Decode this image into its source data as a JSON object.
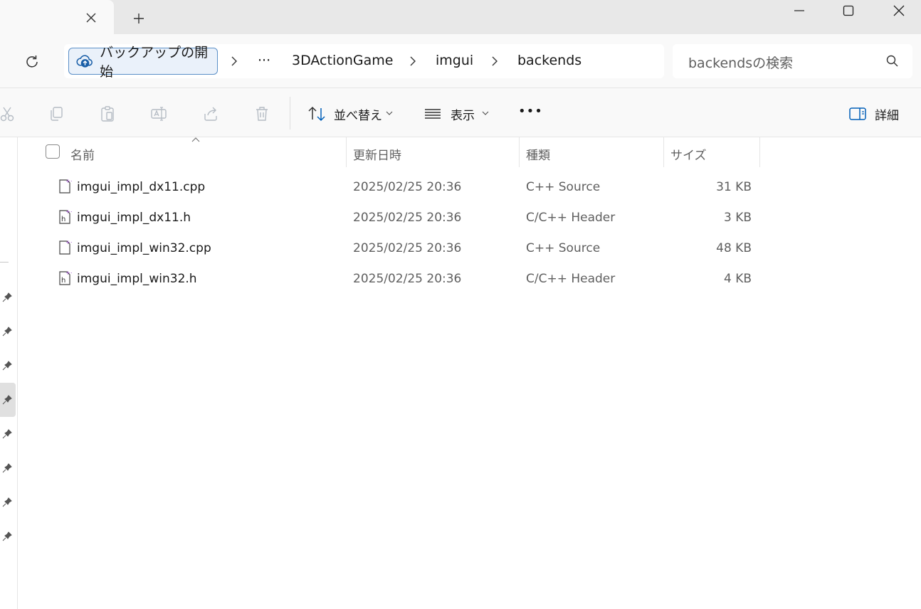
{
  "window": {
    "tab_close_icon": "close-icon",
    "new_tab_icon": "plus-icon",
    "controls": [
      "minimize-icon",
      "maximize-icon",
      "close-icon"
    ]
  },
  "address": {
    "backup_label": "バックアップの開始",
    "more": "···",
    "crumbs": [
      "3DActionGame",
      "imgui",
      "backends"
    ]
  },
  "search": {
    "placeholder": "backendsの検索"
  },
  "toolbar": {
    "sort_label": "並べ替え",
    "view_label": "表示",
    "more": "•••",
    "details_label": "詳細"
  },
  "columns": {
    "name": "名前",
    "modified": "更新日時",
    "type": "種類",
    "size": "サイズ"
  },
  "files": [
    {
      "name": "imgui_impl_dx11.cpp",
      "modified": "2025/02/25 20:36",
      "type": "C++ Source",
      "size": "31 KB",
      "icon": "cpp-file-icon"
    },
    {
      "name": "imgui_impl_dx11.h",
      "modified": "2025/02/25 20:36",
      "type": "C/C++ Header",
      "size": "3 KB",
      "icon": "header-file-icon"
    },
    {
      "name": "imgui_impl_win32.cpp",
      "modified": "2025/02/25 20:36",
      "type": "C++ Source",
      "size": "48 KB",
      "icon": "cpp-file-icon"
    },
    {
      "name": "imgui_impl_win32.h",
      "modified": "2025/02/25 20:36",
      "type": "C/C++ Header",
      "size": "4 KB",
      "icon": "header-file-icon"
    }
  ],
  "colors": {
    "accent": "#005fb8",
    "file_badge": "#9b4dca"
  }
}
